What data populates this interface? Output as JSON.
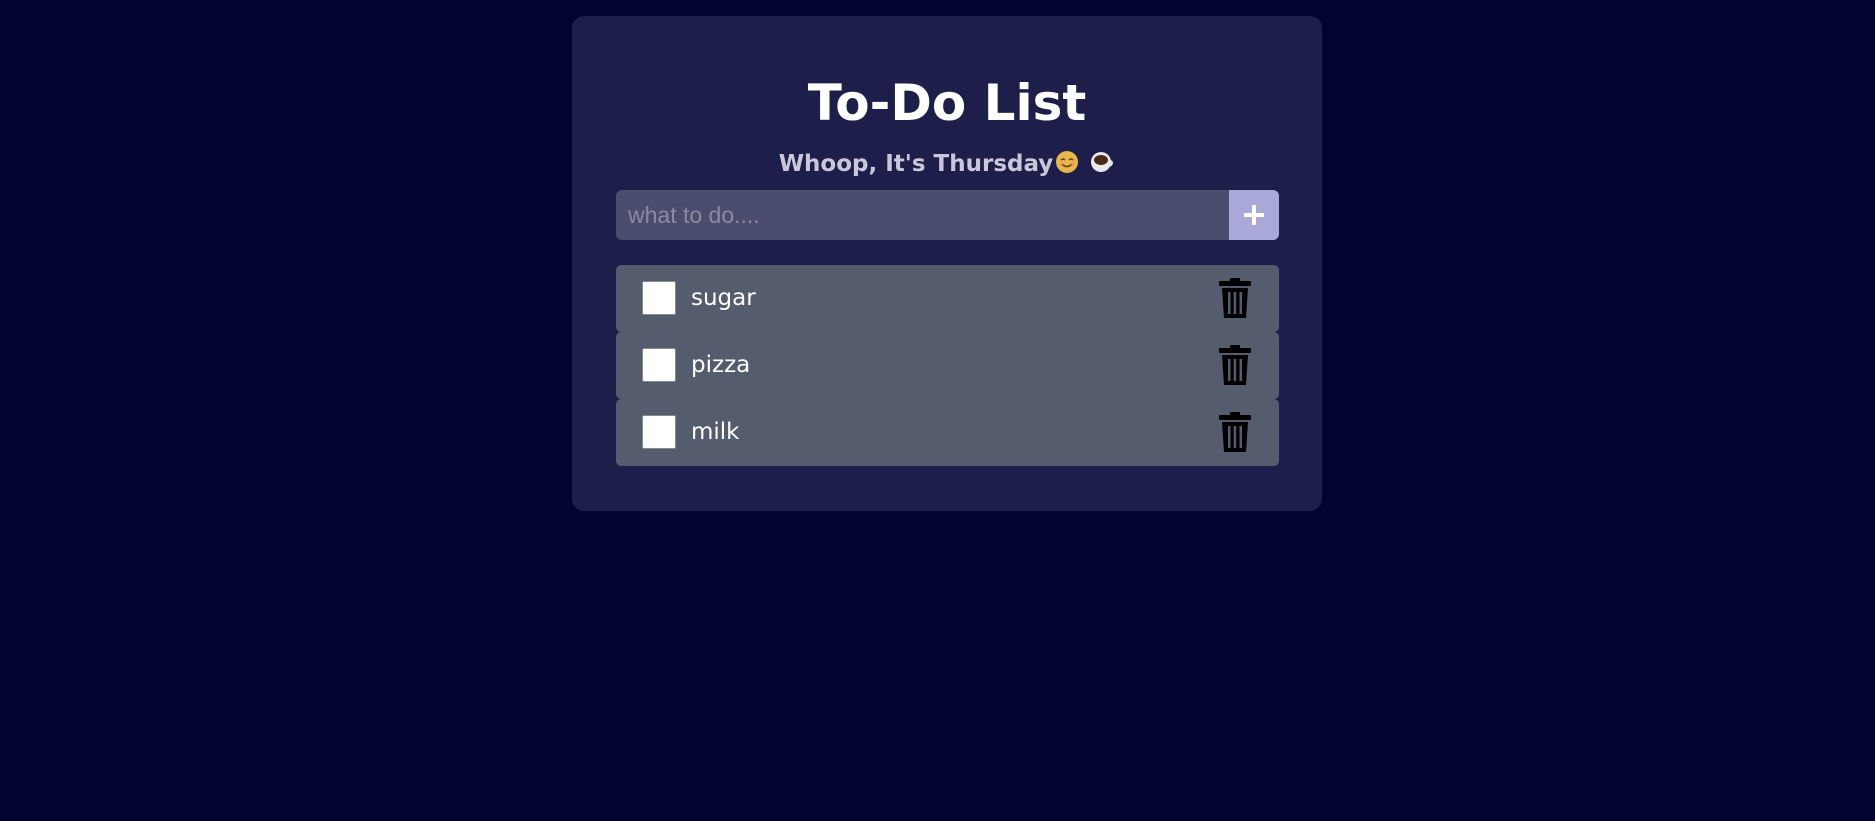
{
  "app": {
    "title": "To-Do List",
    "subtitle": "Whoop, It's Thursday",
    "subtitle_emojis": [
      "smiling-face-emoji",
      "coffee-cup-emoji"
    ]
  },
  "add_form": {
    "input_value": "",
    "input_placeholder": "what to do....",
    "add_button_icon": "plus-icon"
  },
  "todos": [
    {
      "text": "sugar",
      "checked": false
    },
    {
      "text": "pizza",
      "checked": false
    },
    {
      "text": "milk",
      "checked": false
    }
  ],
  "colors": {
    "background": "#01042f",
    "card": "#1d1f4a",
    "input": "#4a4d6d",
    "add_button": "#a8a9d8",
    "item": "#545c6e"
  }
}
